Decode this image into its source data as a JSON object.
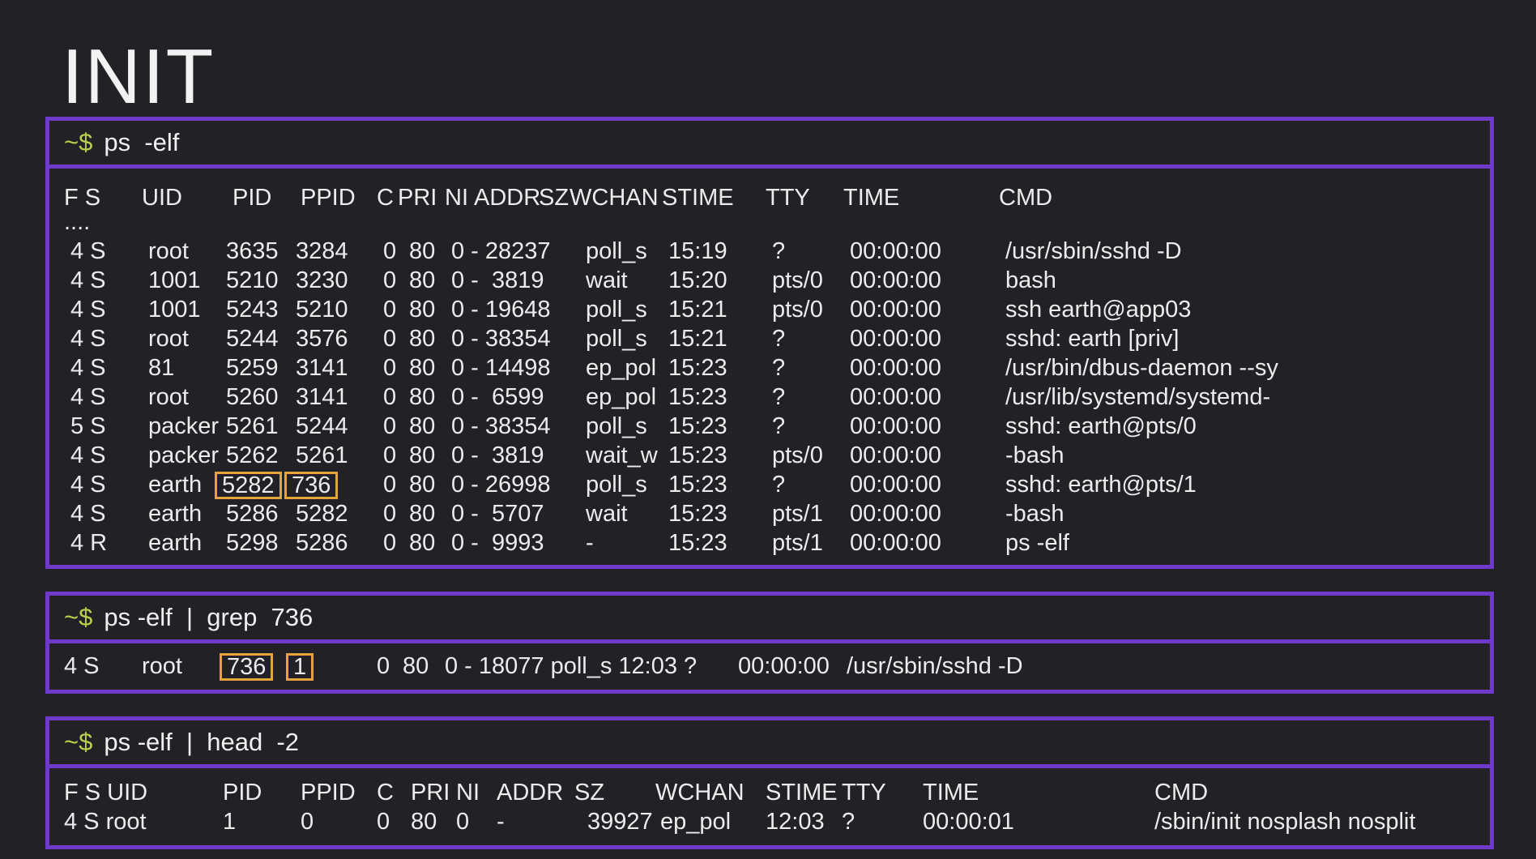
{
  "title": "INIT",
  "colors": {
    "accent": "#6f3ac9",
    "prompt": "#b9d146",
    "highlight": "#e8a33a",
    "background": "#222226"
  },
  "prompt": "~$",
  "panel1": {
    "command": "ps  -elf",
    "headers": [
      "F S",
      "UID",
      "PID",
      "PPID",
      "C",
      "PRI",
      "NI",
      "ADDR",
      "SZ",
      "WCHAN",
      "STIME",
      "TTY",
      "TIME",
      "CMD"
    ],
    "ellipsis": "....",
    "rows": [
      [
        "4 S",
        "root",
        "3635",
        "3284",
        "0",
        "80",
        "0 - 28237",
        "poll_s",
        "15:19",
        "?",
        "00:00:00",
        "/usr/sbin/sshd -D"
      ],
      [
        "4 S",
        "1001",
        "5210",
        "3230",
        "0",
        "80",
        "0 -  3819",
        "wait",
        "15:20",
        "pts/0",
        "00:00:00",
        "bash"
      ],
      [
        "4 S",
        "1001",
        "5243",
        "5210",
        "0",
        "80",
        "0 - 19648",
        "poll_s",
        "15:21",
        "pts/0",
        "00:00:00",
        "ssh earth@app03"
      ],
      [
        "4 S",
        "root",
        "5244",
        "3576",
        "0",
        "80",
        "0 - 38354",
        "poll_s",
        "15:21",
        "?",
        "00:00:00",
        "sshd: earth [priv]"
      ],
      [
        "4 S",
        "81",
        "5259",
        "3141",
        "0",
        "80",
        "0 - 14498",
        "ep_pol",
        "15:23",
        "?",
        "00:00:00",
        "/usr/bin/dbus-daemon --sy"
      ],
      [
        "4 S",
        "root",
        "5260",
        "3141",
        "0",
        "80",
        "0 -  6599",
        "ep_pol",
        "15:23",
        "?",
        "00:00:00",
        "/usr/lib/systemd/systemd-"
      ],
      [
        "5 S",
        "packer",
        "5261",
        "5244",
        "0",
        "80",
        "0 - 38354",
        "poll_s",
        "15:23",
        "?",
        "00:00:00",
        "sshd: earth@pts/0"
      ],
      [
        "4 S",
        "packer",
        "5262",
        "5261",
        "0",
        "80",
        "0 -  3819",
        "wait_w",
        "15:23",
        "pts/0",
        "00:00:00",
        "-bash"
      ],
      [
        "4 S",
        "earth",
        "5282",
        "736",
        "0",
        "80",
        "0 - 26998",
        "poll_s",
        "15:23",
        "?",
        "00:00:00",
        "sshd: earth@pts/1"
      ],
      [
        "4 S",
        "earth",
        "5286",
        "5282",
        "0",
        "80",
        "0 -  5707",
        "wait",
        "15:23",
        "pts/1",
        "00:00:00",
        "-bash"
      ],
      [
        "4 R",
        "earth",
        "5298",
        "5286",
        "0",
        "80",
        "0 -  9993",
        "-",
        "15:23",
        "pts/1",
        "00:00:00",
        "ps -elf"
      ]
    ]
  },
  "panel2": {
    "command": "ps -elf  |  grep  736",
    "row": {
      "fs": "4 S",
      "uid": "root",
      "pid": "736",
      "ppid": "1",
      "c": "0",
      "pri": "80",
      "rest": "0 - 18077 poll_s 12:03 ?",
      "time": "00:00:00",
      "cmd": "/usr/sbin/sshd -D"
    }
  },
  "panel3": {
    "command": "ps -elf  |  head  -2",
    "headers": [
      "F S UID",
      "PID",
      "PPID",
      "C",
      "PRI",
      "NI",
      "ADDR",
      "SZ",
      "WCHAN",
      "STIME",
      "TTY",
      "TIME",
      "CMD"
    ],
    "row": [
      "4 S root",
      "1",
      "0",
      "0",
      "80",
      "0",
      "-",
      "39927",
      "ep_pol",
      "12:03",
      "?",
      "00:00:01",
      "/sbin/init nosplash nosplit"
    ]
  }
}
